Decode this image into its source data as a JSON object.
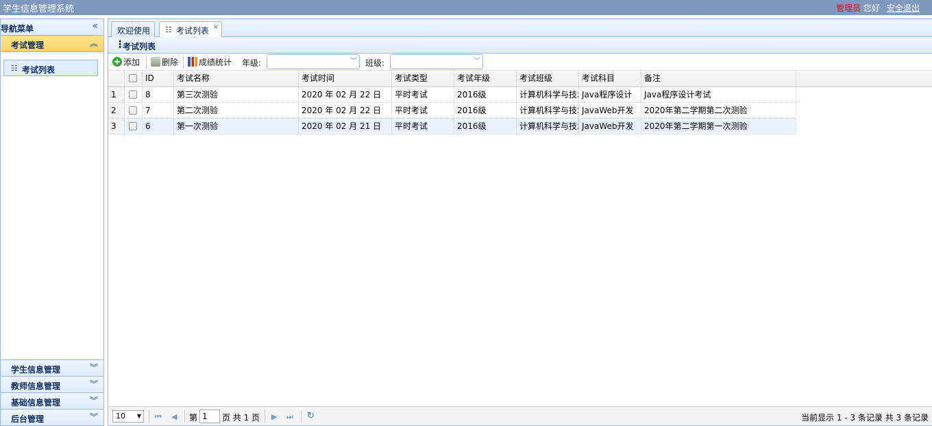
{
  "header": {
    "title": "学生信息管理系统",
    "user_role": "管理员",
    "greeting": "您好",
    "logout": "安全退出"
  },
  "sidebar": {
    "nav_title": "导航菜单",
    "active_group": "考试管理",
    "active_item": "考试列表",
    "groups": [
      "学生信息管理",
      "教师信息管理",
      "基础信息管理",
      "后台管理"
    ]
  },
  "tabs": [
    {
      "label": "欢迎使用",
      "closable": false
    },
    {
      "label": "考试列表",
      "closable": true
    }
  ],
  "panel": {
    "title": "考试列表"
  },
  "toolbar": {
    "add": "添加",
    "delete": "删除",
    "stats": "成绩统计",
    "grade_label": "年级:",
    "class_label": "班级:",
    "grade_value": "",
    "class_value": ""
  },
  "table": {
    "columns": [
      "ID",
      "考试名称",
      "考试时间",
      "考试类型",
      "考试年级",
      "考试班级",
      "考试科目",
      "备注"
    ],
    "rows": [
      {
        "num": "1",
        "id": "8",
        "name": "第三次测验",
        "time": "2020 年 02 月 22 日",
        "type": "平时考试",
        "grade": "2016级",
        "clazz": "计算机科学与技术",
        "subject": "Java程序设计",
        "remark": "Java程序设计考试"
      },
      {
        "num": "2",
        "id": "7",
        "name": "第二次测验",
        "time": "2020 年 02 月 22 日",
        "type": "平时考试",
        "grade": "2016级",
        "clazz": "计算机科学与技术",
        "subject": "JavaWeb开发",
        "remark": "2020年第二学期第二次测验"
      },
      {
        "num": "3",
        "id": "6",
        "name": "第一次测验",
        "time": "2020 年 02 月 21 日",
        "type": "平时考试",
        "grade": "2016级",
        "clazz": "计算机科学与技术",
        "subject": "JavaWeb开发",
        "remark": "2020年第二学期第一次测验"
      }
    ]
  },
  "pager": {
    "page_size": "10",
    "page_prefix": "第",
    "current_page": "1",
    "page_suffix": "页 共 1 页",
    "info": "当前显示 1 - 3 条记录 共 3 条记录"
  }
}
